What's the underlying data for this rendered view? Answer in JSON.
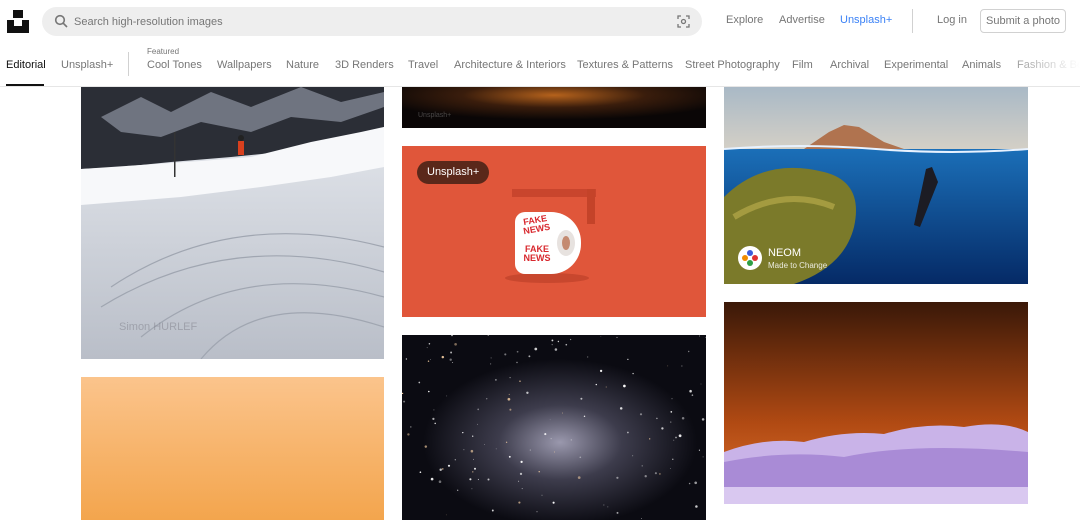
{
  "header": {
    "search_placeholder": "Search high-resolution images",
    "nav": {
      "explore": "Explore",
      "advertise": "Advertise",
      "unsplash_plus": "Unsplash+"
    },
    "login": "Log in",
    "submit": "Submit a photo"
  },
  "topics": {
    "featured_label": "Featured",
    "items": [
      "Editorial",
      "Unsplash+",
      "Cool Tones",
      "Wallpapers",
      "Nature",
      "3D Renders",
      "Travel",
      "Architecture & Interiors",
      "Textures & Patterns",
      "Street Photography",
      "Film",
      "Archival",
      "Experimental",
      "Animals",
      "Fashion & Be"
    ],
    "active": "Editorial"
  },
  "photos": {
    "snow": {
      "author_watermark": "Simon HURLEF"
    },
    "dark_top": {
      "watermark": "Unsplash+"
    },
    "fake_news": {
      "badge": "Unsplash+",
      "roll_text_1": "FAKE NEWS",
      "roll_text_2": "FAKE NEWS"
    },
    "sea": {
      "sponsor_name": "NEOM",
      "sponsor_tagline": "Made to Change"
    }
  },
  "colors": {
    "accent_link": "#3b82f6",
    "orange_bg": "#e0563a",
    "search_bg": "#eeeeee"
  },
  "icons": [
    "unsplash-logo-icon",
    "search-icon",
    "visual-search-icon",
    "neom-logo-icon"
  ]
}
